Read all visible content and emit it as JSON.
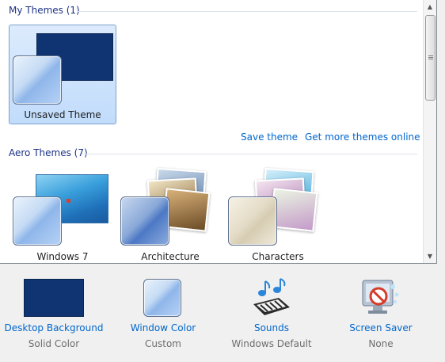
{
  "my_themes": {
    "heading": "My Themes (1)",
    "items": [
      {
        "name": "Unsaved Theme",
        "selected": true,
        "wallpaper_color": "#0f3471",
        "glass": "light-blue"
      }
    ]
  },
  "links": {
    "save_theme": "Save theme",
    "get_more": "Get more themes online"
  },
  "aero_themes": {
    "heading": "Aero Themes (7)",
    "items": [
      {
        "name": "Windows 7",
        "glass": "light-blue"
      },
      {
        "name": "Architecture",
        "glass": "blue"
      },
      {
        "name": "Characters",
        "glass": "beige"
      }
    ]
  },
  "bottom_bar": [
    {
      "label": "Desktop Background",
      "value": "Solid Color",
      "icon": "solid-color-swatch-icon",
      "color": "#0f3471"
    },
    {
      "label": "Window Color",
      "value": "Custom",
      "icon": "window-color-swatch-icon"
    },
    {
      "label": "Sounds",
      "value": "Windows Default",
      "icon": "sounds-icon"
    },
    {
      "label": "Screen Saver",
      "value": "None",
      "icon": "screen-saver-icon"
    }
  ],
  "colors": {
    "link": "#0066cc",
    "heading": "#1e3287",
    "selection": "#c1dcfc"
  }
}
